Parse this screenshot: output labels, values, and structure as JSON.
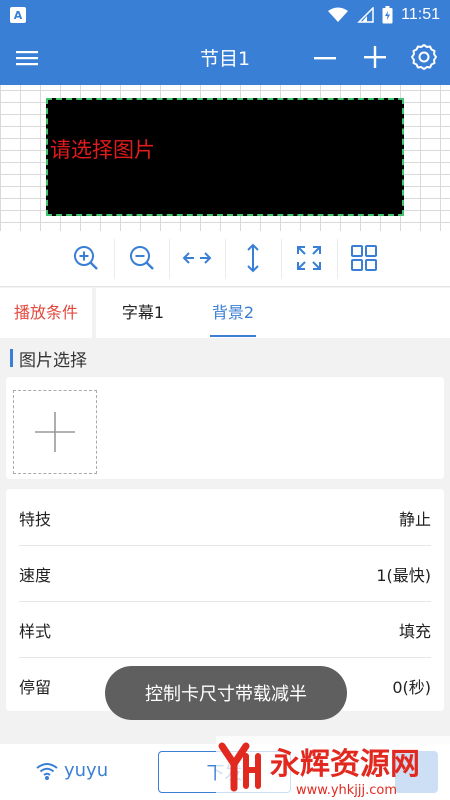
{
  "status_bar": {
    "time": "11:51",
    "app_icon_letter": "A"
  },
  "app_bar": {
    "title": "节目1",
    "icons": [
      "menu-icon",
      "minus-icon",
      "plus-icon",
      "settings-icon"
    ]
  },
  "canvas": {
    "screen_text": "请选择图片",
    "screen_text_color": "#e01b1b",
    "border_color": "#41c46a"
  },
  "toolbar": {
    "icons": [
      "zoom-in-icon",
      "zoom-out-icon",
      "horizontal-stretch-icon",
      "vertical-stretch-icon",
      "fullscreen-icon",
      "grid-icon"
    ]
  },
  "tabs": [
    {
      "label": "播放条件"
    },
    {
      "label": "字幕1"
    },
    {
      "label": "背景2"
    }
  ],
  "section": {
    "title": "图片选择"
  },
  "settings": [
    {
      "label": "特技",
      "value": "静止"
    },
    {
      "label": "速度",
      "value": "1(最快)"
    },
    {
      "label": "样式",
      "value": "填充"
    },
    {
      "label": "停留",
      "value": "0(秒)"
    }
  ],
  "toast": {
    "text": "控制卡尺寸带载减半"
  },
  "bottom_bar": {
    "wifi_label": "yuyu",
    "send_label": "下发"
  },
  "watermark": {
    "brand": "永辉资源网",
    "url": "www.yhkjjj.com"
  },
  "colors": {
    "primary": "#3a7fd6",
    "active_tab_red": "#e2483e",
    "toast_bg": "#5f5f5f"
  }
}
